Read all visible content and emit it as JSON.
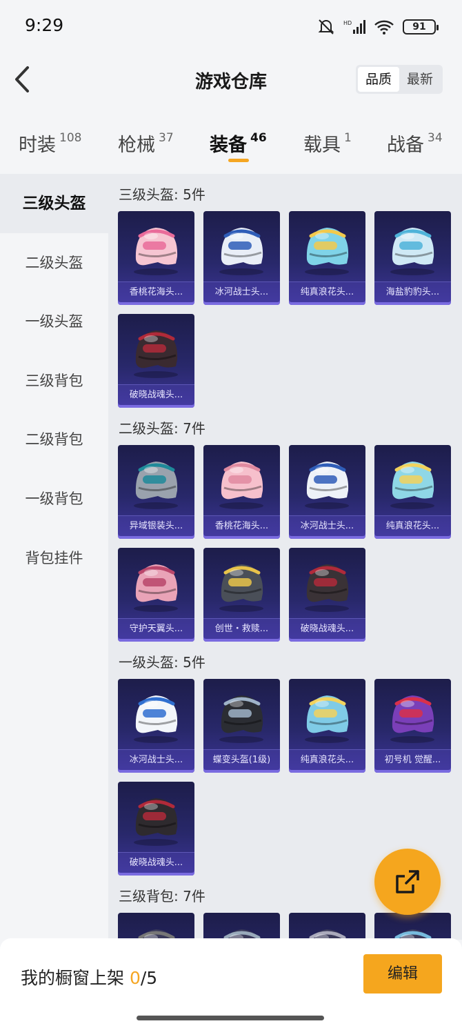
{
  "status": {
    "time": "9:29",
    "battery": "91"
  },
  "header": {
    "title": "游戏仓库",
    "sort_options": [
      "品质",
      "最新"
    ],
    "active_sort": "品质"
  },
  "tabs": [
    {
      "label": "时装",
      "count": "108"
    },
    {
      "label": "枪械",
      "count": "37"
    },
    {
      "label": "装备",
      "count": "46",
      "active": true
    },
    {
      "label": "载具",
      "count": "1"
    },
    {
      "label": "战备",
      "count": "34"
    }
  ],
  "sidebar": [
    {
      "label": "三级头盔",
      "active": true
    },
    {
      "label": "二级头盔"
    },
    {
      "label": "一级头盔"
    },
    {
      "label": "三级背包"
    },
    {
      "label": "二级背包"
    },
    {
      "label": "一级背包"
    },
    {
      "label": "背包挂件"
    }
  ],
  "sections": [
    {
      "title": "三级头盔: 5件",
      "items": [
        {
          "name": "香桃花海头...",
          "color": "#f6c5d2",
          "accent": "#e96b9a",
          "icon": "helmet-level3-icon"
        },
        {
          "name": "冰河战士头...",
          "color": "#e9eef7",
          "accent": "#2f5db8",
          "icon": "helmet-level3-icon"
        },
        {
          "name": "纯真浪花头...",
          "color": "#7fd3e8",
          "accent": "#f2c94c",
          "icon": "helmet-level3-icon"
        },
        {
          "name": "海盐豹豹头...",
          "color": "#cfe9f5",
          "accent": "#4fb3d9",
          "icon": "helmet-level3-icon"
        },
        {
          "name": "破晓战魂头...",
          "color": "#3a2a30",
          "accent": "#b02a3a",
          "icon": "helmet-level3-icon"
        }
      ]
    },
    {
      "title": "二级头盔: 7件",
      "items": [
        {
          "name": "异域银装头...",
          "color": "#9aa2ad",
          "accent": "#1f8a9a",
          "icon": "helmet-level2-icon"
        },
        {
          "name": "香桃花海头...",
          "color": "#f6c0cc",
          "accent": "#e08aa0",
          "icon": "helmet-level2-icon"
        },
        {
          "name": "冰河战士头...",
          "color": "#eef2f8",
          "accent": "#2f5db8",
          "icon": "helmet-level2-icon"
        },
        {
          "name": "纯真浪花头...",
          "color": "#8fd7e6",
          "accent": "#f2d25c",
          "icon": "helmet-level2-icon"
        },
        {
          "name": "守护天翼头...",
          "color": "#e9a3b7",
          "accent": "#b9476b",
          "icon": "helmet-level2-icon"
        },
        {
          "name": "创世・救赎...",
          "color": "#4a4f58",
          "accent": "#e8c34a",
          "icon": "helmet-level2-icon"
        },
        {
          "name": "破晓战魂头...",
          "color": "#3a3236",
          "accent": "#b02a3a",
          "icon": "helmet-level2-icon"
        }
      ]
    },
    {
      "title": "一级头盔: 5件",
      "items": [
        {
          "name": "冰河战士头...",
          "color": "#f3f6fa",
          "accent": "#2f6fd0",
          "icon": "helmet-level1-icon"
        },
        {
          "name": "蝶变头盔(1级)",
          "color": "#2b2d33",
          "accent": "#9fb3c8",
          "icon": "helmet-level1-icon"
        },
        {
          "name": "纯真浪花头...",
          "color": "#7fcbe6",
          "accent": "#f2d25c",
          "icon": "helmet-level1-icon"
        },
        {
          "name": "初号机 觉醒...",
          "color": "#7a3fb8",
          "accent": "#d9304a",
          "icon": "helmet-level1-icon"
        },
        {
          "name": "破晓战魂头...",
          "color": "#2e2a2e",
          "accent": "#b02a3a",
          "icon": "helmet-level1-icon"
        }
      ]
    },
    {
      "title": "三级背包: 7件",
      "items": [
        {
          "name": "",
          "color": "#3a3a5a",
          "accent": "#777",
          "icon": "backpack-icon"
        },
        {
          "name": "",
          "color": "#3a3a5a",
          "accent": "#9ab",
          "icon": "backpack-icon"
        },
        {
          "name": "",
          "color": "#3a3a5a",
          "accent": "#aab",
          "icon": "backpack-icon"
        },
        {
          "name": "",
          "color": "#3a3a5a",
          "accent": "#7bd",
          "icon": "backpack-icon"
        }
      ]
    }
  ],
  "bottom": {
    "label": "我的橱窗上架 ",
    "count": "0",
    "total": "/5",
    "edit_label": "编辑"
  },
  "colors": {
    "accent": "#f5a623",
    "card_bg": "#28286a"
  }
}
